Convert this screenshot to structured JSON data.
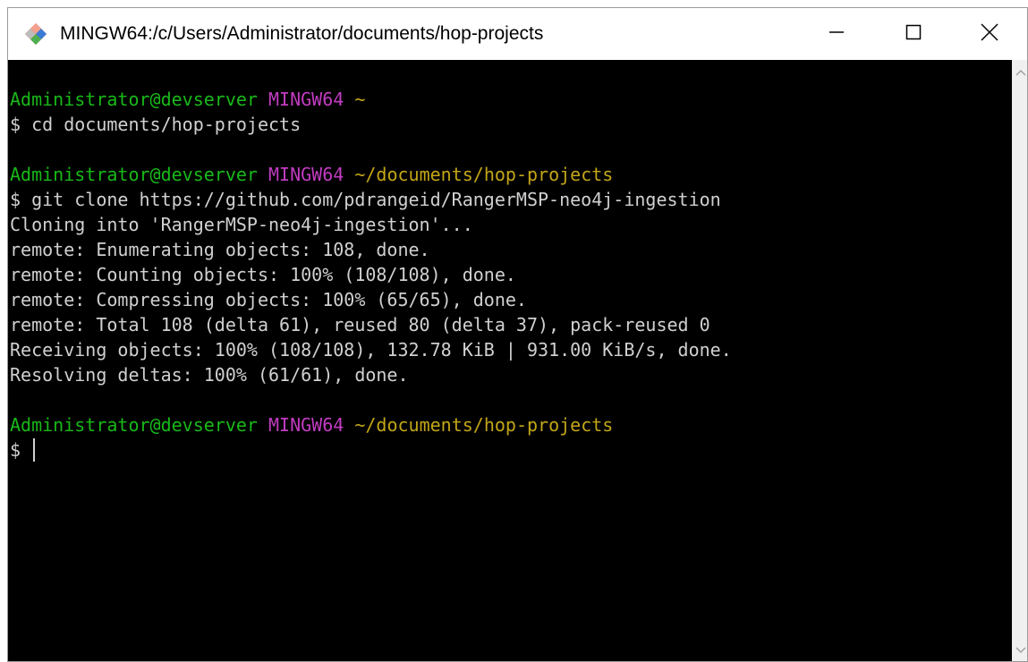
{
  "window": {
    "title": "MINGW64:/c/Users/Administrator/documents/hop-projects",
    "icon": "git-bash-diamond-icon",
    "controls": [
      "minimize-icon",
      "maximize-icon",
      "close-icon"
    ]
  },
  "colors": {
    "user_host": "#19b919",
    "env": "#c13cc1",
    "path": "#c3a617",
    "output": "#d0d0d0",
    "background": "#000000"
  },
  "terminal": {
    "prompt1": {
      "user": "Administrator@devserver",
      "env": "MINGW64",
      "path": "~",
      "command": "$ cd documents/hop-projects"
    },
    "prompt2": {
      "user": "Administrator@devserver",
      "env": "MINGW64",
      "path": "~/documents/hop-projects",
      "command": "$ git clone https://github.com/pdrangeid/RangerMSP-neo4j-ingestion"
    },
    "output": [
      "Cloning into 'RangerMSP-neo4j-ingestion'...",
      "remote: Enumerating objects: 108, done.",
      "remote: Counting objects: 100% (108/108), done.",
      "remote: Compressing objects: 100% (65/65), done.",
      "remote: Total 108 (delta 61), reused 80 (delta 37), pack-reused 0",
      "Receiving objects: 100% (108/108), 132.78 KiB | 931.00 KiB/s, done.",
      "Resolving deltas: 100% (61/61), done."
    ],
    "prompt3": {
      "user": "Administrator@devserver",
      "env": "MINGW64",
      "path": "~/documents/hop-projects",
      "command": "$ "
    }
  }
}
